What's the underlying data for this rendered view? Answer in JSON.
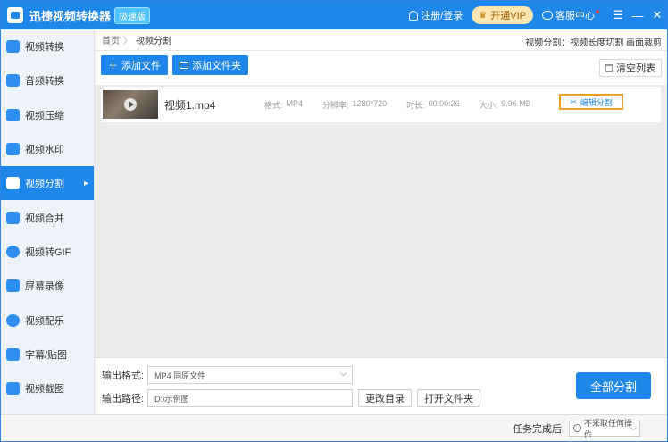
{
  "titlebar": {
    "title": "迅捷视频转换器",
    "edition": "极速版",
    "login": "注册/登录",
    "vip": "开通VIP",
    "service": "客服中心",
    "menu_glyph": "☰",
    "min_glyph": "—",
    "close_glyph": "✕"
  },
  "sidebar": {
    "items": [
      {
        "label": "视频转换"
      },
      {
        "label": "音频转换"
      },
      {
        "label": "视频压缩"
      },
      {
        "label": "视频水印"
      },
      {
        "label": "视频分割"
      },
      {
        "label": "视频合并"
      },
      {
        "label": "视频转GIF"
      },
      {
        "label": "屏幕录像"
      },
      {
        "label": "视频配乐"
      },
      {
        "label": "字幕/贴图"
      },
      {
        "label": "视频截图"
      }
    ],
    "active_index": 4
  },
  "breadcrumb": {
    "home": "首页",
    "separator": "〉",
    "current": "视频分割",
    "right_text": "视频分割：视频长度切割 画面裁剪"
  },
  "toolbar": {
    "add_file": "添加文件",
    "add_folder": "添加文件夹",
    "clear_list": "清空列表"
  },
  "file": {
    "name": "视频1.mp4",
    "format_label": "格式:",
    "format": "MP4",
    "resolution_label": "分辨率:",
    "resolution": "1280*720",
    "duration_label": "时长:",
    "duration": "00:00:26",
    "size_label": "大小:",
    "size": "9.96 MB",
    "edit_button": "编辑分割"
  },
  "output": {
    "format_label": "输出格式:",
    "format_value": "MP4  同原文件",
    "path_label": "输出路径:",
    "path_value": "D:\\示例图",
    "change_dir": "更改目录",
    "open_folder": "打开文件夹",
    "split_all": "全部分割"
  },
  "status": {
    "after_label": "任务完成后",
    "after_value": "不采取任何操作"
  },
  "colors": {
    "accent": "#1f86ea",
    "highlight_border": "#f0a020",
    "vip_bg": "#fde6b0"
  }
}
